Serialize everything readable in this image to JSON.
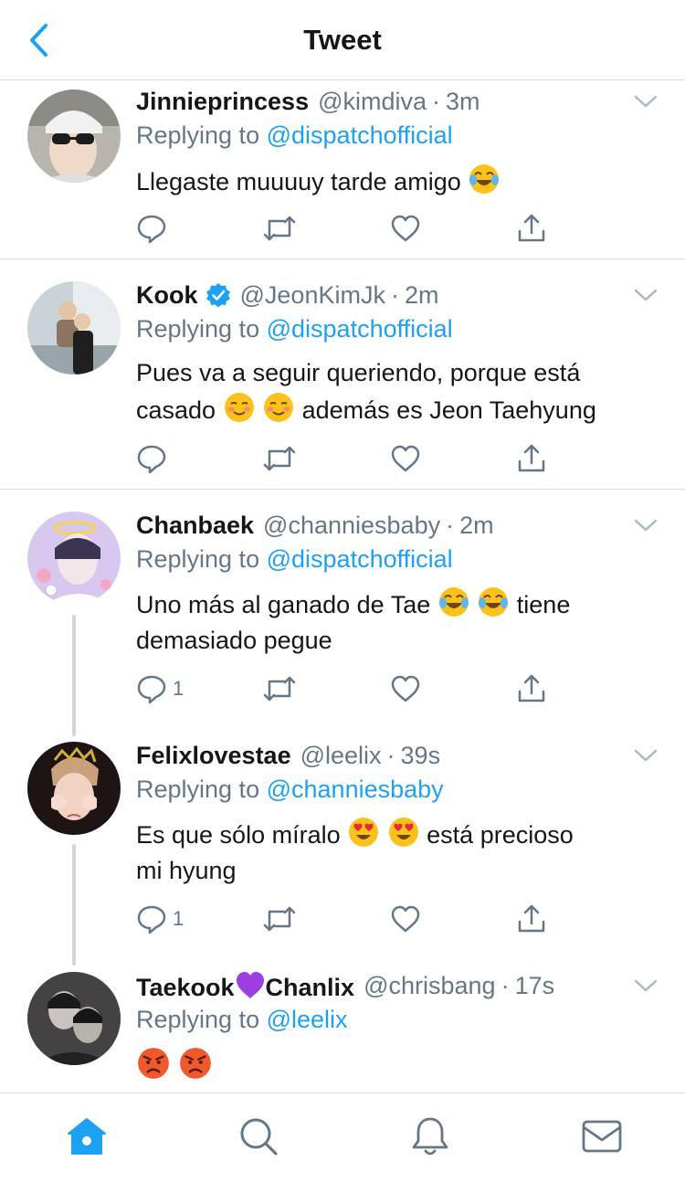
{
  "header": {
    "title": "Tweet"
  },
  "colors": {
    "accent": "#1da1f2",
    "muted": "#657786",
    "text": "#14171a",
    "divider": "#d9dde0"
  },
  "tweets": [
    {
      "name": "Jinnieprincess",
      "handle": "@kimdiva",
      "time": "3m",
      "reply_prefix": "Replying to",
      "reply_mention": "@dispatchofficial",
      "text": "Llegaste muuuuy tarde amigo",
      "reply_count": "",
      "emoji": [
        "face-with-tears-of-joy"
      ]
    },
    {
      "name": "Kook",
      "verified": true,
      "handle": "@JeonKimJk",
      "time": "2m",
      "reply_prefix": "Replying to",
      "reply_mention": "@dispatchofficial",
      "text_line1": "Pues va a seguir queriendo, porque está",
      "text_line2a": "casado",
      "text_line2b": "además es Jeon Taehyung",
      "reply_count": "",
      "emoji": [
        "smiling-face",
        "smiling-face"
      ]
    },
    {
      "name": "Chanbaek",
      "handle": "@channiesbaby",
      "time": "2m",
      "reply_prefix": "Replying to",
      "reply_mention": "@dispatchofficial",
      "text_line1a": "Uno más al ganado de Tae",
      "text_line1b": "tiene",
      "text_line2": "demasiado pegue",
      "reply_count": "1",
      "emoji": [
        "face-with-tears-of-joy",
        "face-with-tears-of-joy"
      ]
    },
    {
      "name": "Felixlovestae",
      "handle": "@leelix",
      "time": "39s",
      "reply_prefix": "Replying to",
      "reply_mention": "@channiesbaby",
      "text_line1a": "Es que sólo míralo",
      "text_line1b": "está precioso",
      "text_line2": "mi hyung",
      "reply_count": "1",
      "emoji": [
        "heart-eyes",
        "heart-eyes"
      ]
    },
    {
      "name_a": "Taekook",
      "name_b": "Chanlix",
      "handle": "@chrisbang",
      "time": "17s",
      "reply_prefix": "Replying to",
      "reply_mention": "@leelix",
      "emoji": [
        "purple-heart",
        "angry-face",
        "angry-face"
      ]
    }
  ],
  "tabs": [
    "home-icon",
    "search-icon",
    "notifications-bell-icon",
    "messages-envelope-icon"
  ]
}
